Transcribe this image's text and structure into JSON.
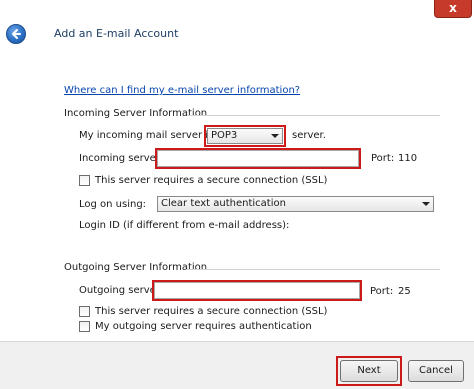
{
  "header": {
    "title": "Add an E-mail Account",
    "close_glyph": "x"
  },
  "help_link": "Where can I find my e-mail server information?",
  "incoming": {
    "group_label": "Incoming Server Information",
    "server_type_prefix": "My incoming mail server is a",
    "server_type_value": "POP3",
    "server_type_suffix": "server.",
    "server_label": "Incoming server:",
    "server_value": "",
    "port_label": "Port:",
    "port_value": "110",
    "ssl_label": "This server requires a secure connection (SSL)",
    "logon_label": "Log on using:",
    "logon_value": "Clear text authentication",
    "login_id_label": "Login ID (if different from e-mail address):"
  },
  "outgoing": {
    "group_label": "Outgoing Server Information",
    "server_label": "Outgoing server:",
    "server_value": "",
    "port_label": "Port:",
    "port_value": "25",
    "ssl_label": "This server requires a secure connection (SSL)",
    "auth_label": "My outgoing server requires authentication"
  },
  "footer": {
    "next_label": "Next",
    "cancel_label": "Cancel"
  },
  "colors": {
    "highlight": "#cc1a1a",
    "link": "#0645ad",
    "close": "#c63a2a"
  },
  "icons": {
    "back": "back-arrow-icon",
    "close": "close-icon",
    "dropdown": "chevron-down-icon"
  }
}
